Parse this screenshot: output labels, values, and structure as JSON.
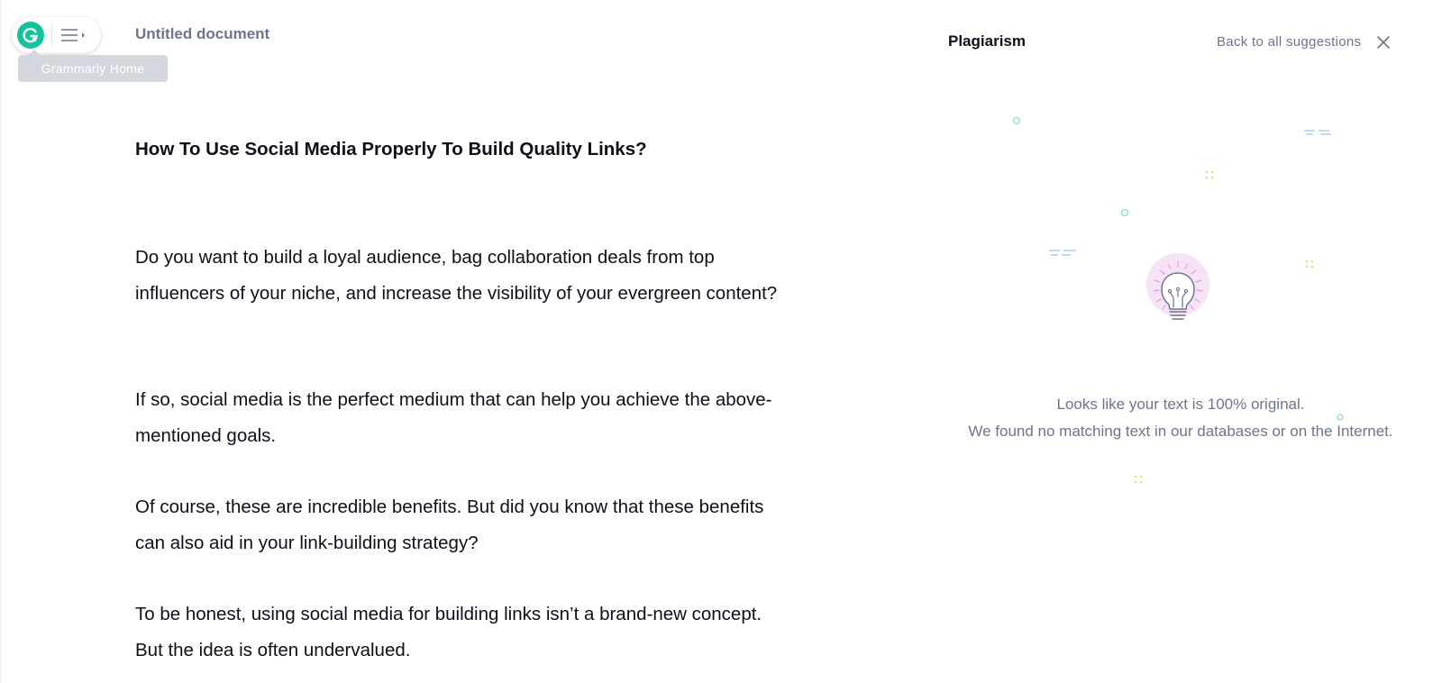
{
  "app": {
    "home_tooltip": "Grammarly Home",
    "doc_title": "Untitled document"
  },
  "document": {
    "heading": "How To Use Social Media Properly To Build Quality Links?",
    "paragraphs": [
      "Do you want to build a loyal audience, bag collaboration deals from top influencers of your niche, and increase the visibility of your evergreen content?",
      "If so, social media is the perfect medium that can help you achieve the above-mentioned goals.",
      "Of course, these are incredible benefits. But did you know that these benefits can also aid in your link-building strategy?",
      "To be honest, using social media for building links isn’t a brand-new concept. But the idea is often undervalued."
    ]
  },
  "panel": {
    "title": "Plagiarism",
    "back_label": "Back to all suggestions",
    "result_line1": "Looks like your text is 100% original.",
    "result_line2": "We found no matching text in our databases or on the Internet."
  },
  "icons": {
    "logo": "grammarly-g-icon",
    "menu": "hamburger-menu-icon",
    "close": "close-icon",
    "illustration": "lightbulb-icon"
  },
  "colors": {
    "brand": "#15c39a",
    "muted_text": "#6d758d",
    "body_text": "#0e101a",
    "tooltip_bg": "#d5d7de",
    "bulb_glow": "#f6e3f6"
  }
}
